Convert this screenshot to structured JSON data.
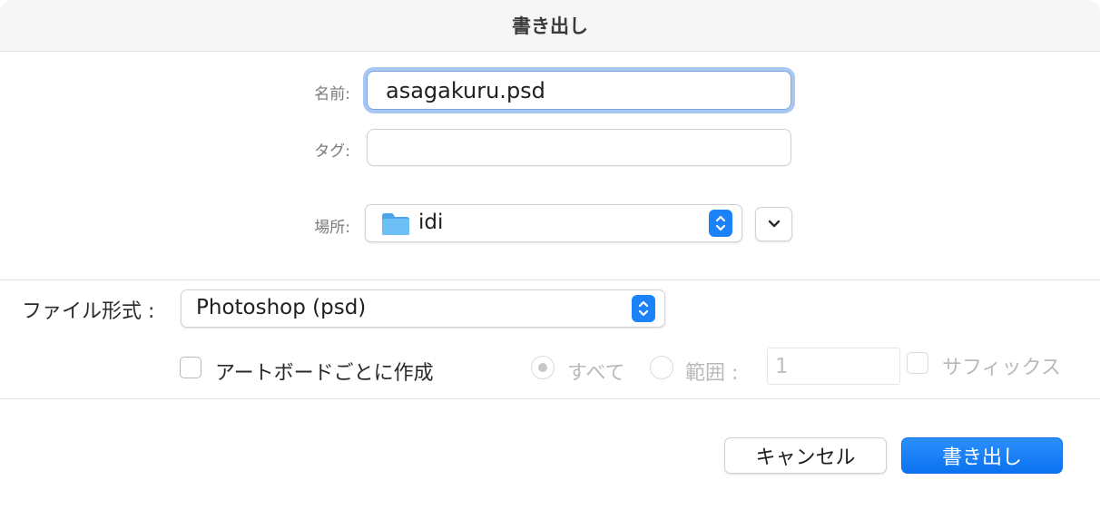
{
  "dialog": {
    "title": "書き出し",
    "name_label": "名前:",
    "name_value": "asagakuru.psd",
    "tags_label": "タグ:",
    "tags_value": "",
    "where_label": "場所:",
    "where_value": "idi",
    "where_icon": "folder-icon",
    "expand_icon": "chevron-down-icon"
  },
  "options": {
    "format_label": "ファイル形式 :",
    "format_value": "Photoshop (psd)",
    "artboard_checkbox_label": "アートボードごとに作成",
    "artboard_checked": false,
    "all_label": "すべて",
    "all_selected": true,
    "range_label": "範囲 :",
    "range_value": "1",
    "suffix_label": "サフィックス",
    "suffix_checked": false
  },
  "buttons": {
    "cancel": "キャンセル",
    "export": "書き出し"
  },
  "colors": {
    "accent": "#1c82f7",
    "focus_ring": "#a9c7f3",
    "folder": "#5bb3f0"
  }
}
